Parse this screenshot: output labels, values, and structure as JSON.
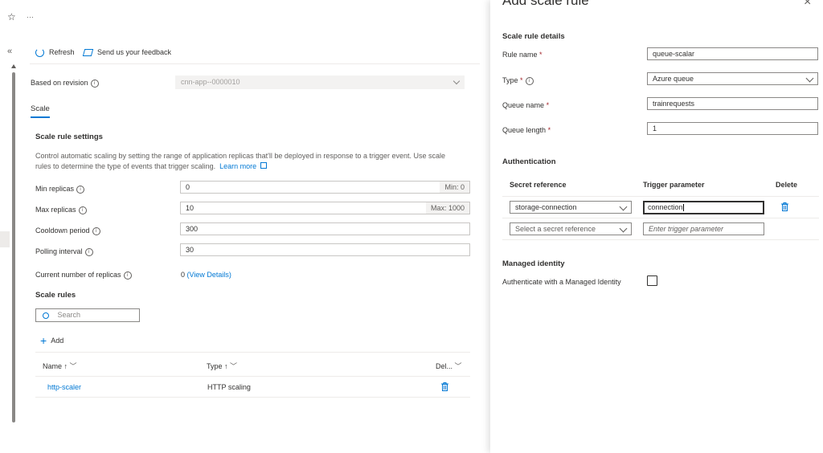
{
  "topbar": {
    "ellipsis": "···"
  },
  "toolbar": {
    "collapse": "«",
    "refresh": "Refresh",
    "feedback": "Send us your feedback"
  },
  "revision": {
    "label": "Based on revision",
    "value": "cnn-app--0000010"
  },
  "tabs": [
    {
      "label": "Scale"
    }
  ],
  "scale_settings": {
    "title": "Scale rule settings",
    "description_line1": "Control automatic scaling by setting the range of application replicas that'll be deployed in response to a trigger event. Use scale",
    "description_line2": "rules to determine the type of events that trigger scaling.",
    "learn_more": "Learn more",
    "min_replicas": {
      "label": "Min replicas",
      "value": "0",
      "suffix": "Min: 0"
    },
    "max_replicas": {
      "label": "Max replicas",
      "value": "10",
      "suffix": "Max: 1000"
    },
    "cooldown": {
      "label": "Cooldown period",
      "value": "300"
    },
    "polling": {
      "label": "Polling interval",
      "value": "30"
    },
    "current": {
      "label": "Current number of replicas",
      "value": "0",
      "link": "(View Details)"
    }
  },
  "scale_rules": {
    "title": "Scale rules",
    "search_placeholder": "Search",
    "add": "Add",
    "columns": {
      "name": "Name ↑",
      "type": "Type ↑",
      "delete": "Del..."
    },
    "rows": [
      {
        "name": "http-scaler",
        "type": "HTTP scaling"
      }
    ]
  },
  "panel": {
    "title": "Add scale rule",
    "close": "×",
    "details_title": "Scale rule details",
    "rule_name": {
      "label": "Rule name",
      "value": "queue-scalar"
    },
    "type": {
      "label": "Type",
      "value": "Azure queue"
    },
    "queue_name": {
      "label": "Queue name",
      "value": "trainrequests"
    },
    "queue_length": {
      "label": "Queue length",
      "value": "1"
    },
    "auth_title": "Authentication",
    "auth_columns": {
      "secret": "Secret reference",
      "trigger": "Trigger parameter",
      "delete": "Delete"
    },
    "auth_rows": [
      {
        "secret": "storage-connection",
        "trigger": "connection"
      }
    ],
    "auth_new_row": {
      "secret_placeholder": "Select a secret reference",
      "trigger_placeholder": "Enter trigger parameter"
    },
    "managed_identity_title": "Managed identity",
    "managed_identity_label": "Authenticate with a Managed Identity",
    "managed_identity_checked": false
  },
  "colors": {
    "accent": "#0078d4",
    "required": "#a4262c",
    "border": "#8a8886"
  }
}
